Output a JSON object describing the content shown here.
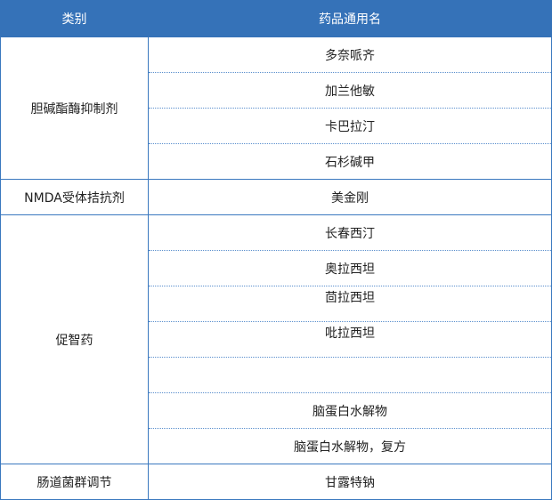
{
  "table": {
    "headers": {
      "category": "类别",
      "drug_name": "药品通用名"
    },
    "groups": [
      {
        "category": "胆碱酯酶抑制剂",
        "drugs": [
          "多奈哌齐",
          "加兰他敏",
          "卡巴拉汀",
          "石杉碱甲"
        ]
      },
      {
        "category": "NMDA受体拮抗剂",
        "drugs": [
          "美金刚"
        ]
      },
      {
        "category": "促智药",
        "drugs": [
          "长春西汀",
          "奥拉西坦",
          "茴拉西坦",
          "吡拉西坦",
          "脑蛋白水解物",
          "脑蛋白水解物，复方"
        ]
      },
      {
        "category": "肠道菌群调节",
        "drugs": [
          "甘露特钠"
        ]
      }
    ]
  },
  "colors": {
    "header_bg": "#3572b8",
    "header_text": "#ffffff",
    "border": "#3a78bf"
  }
}
